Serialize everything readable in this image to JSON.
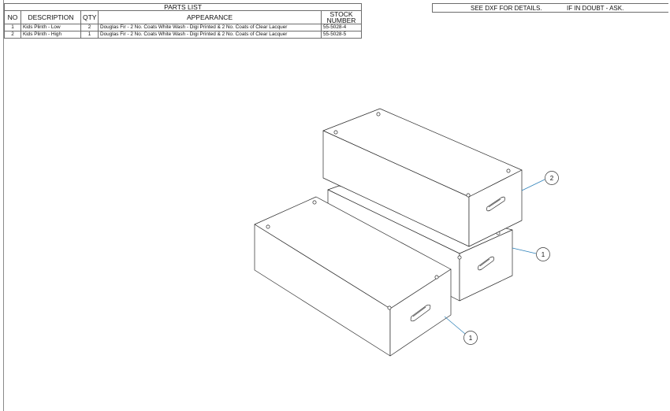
{
  "parts_list": {
    "title": "PARTS LIST",
    "headers": {
      "no": "NO",
      "description": "DESCRIPTION",
      "qty": "QTY",
      "appearance": "APPEARANCE",
      "stock_line1": "STOCK",
      "stock_line2": "NUMBER"
    },
    "rows": [
      {
        "no": "1",
        "description": "Kids Plinth - Low",
        "qty": "2",
        "appearance": "Douglas Fir - 2 No. Coats White Wash - Digi Printed & 2 No. Coats of Clear Lacquer",
        "stock": "55-5028-4"
      },
      {
        "no": "2",
        "description": "Kids Plinth - High",
        "qty": "1",
        "appearance": "Douglas Fir - 2 No. Coats White Wash - Digi Printed & 2 No. Coats of Clear Lacquer",
        "stock": "55-5028-5"
      }
    ]
  },
  "notes": {
    "dxf": "SEE DXF FOR DETAILS.",
    "doubt": "IF IN DOUBT - ASK."
  },
  "balloons": {
    "high": "2",
    "low_back": "1",
    "low_front": "1"
  },
  "colors": {
    "leader": "#2a7fb8",
    "line": "#2b2b2b"
  }
}
